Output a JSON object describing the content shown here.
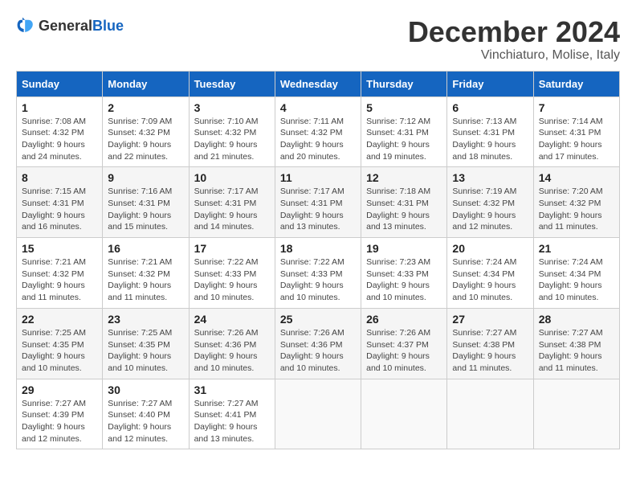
{
  "header": {
    "logo_general": "General",
    "logo_blue": "Blue",
    "month_title": "December 2024",
    "location": "Vinchiaturo, Molise, Italy"
  },
  "weekdays": [
    "Sunday",
    "Monday",
    "Tuesday",
    "Wednesday",
    "Thursday",
    "Friday",
    "Saturday"
  ],
  "weeks": [
    [
      {
        "day": "1",
        "sunrise": "7:08 AM",
        "sunset": "4:32 PM",
        "daylight": "9 hours and 24 minutes."
      },
      {
        "day": "2",
        "sunrise": "7:09 AM",
        "sunset": "4:32 PM",
        "daylight": "9 hours and 22 minutes."
      },
      {
        "day": "3",
        "sunrise": "7:10 AM",
        "sunset": "4:32 PM",
        "daylight": "9 hours and 21 minutes."
      },
      {
        "day": "4",
        "sunrise": "7:11 AM",
        "sunset": "4:32 PM",
        "daylight": "9 hours and 20 minutes."
      },
      {
        "day": "5",
        "sunrise": "7:12 AM",
        "sunset": "4:31 PM",
        "daylight": "9 hours and 19 minutes."
      },
      {
        "day": "6",
        "sunrise": "7:13 AM",
        "sunset": "4:31 PM",
        "daylight": "9 hours and 18 minutes."
      },
      {
        "day": "7",
        "sunrise": "7:14 AM",
        "sunset": "4:31 PM",
        "daylight": "9 hours and 17 minutes."
      }
    ],
    [
      {
        "day": "8",
        "sunrise": "7:15 AM",
        "sunset": "4:31 PM",
        "daylight": "9 hours and 16 minutes."
      },
      {
        "day": "9",
        "sunrise": "7:16 AM",
        "sunset": "4:31 PM",
        "daylight": "9 hours and 15 minutes."
      },
      {
        "day": "10",
        "sunrise": "7:17 AM",
        "sunset": "4:31 PM",
        "daylight": "9 hours and 14 minutes."
      },
      {
        "day": "11",
        "sunrise": "7:17 AM",
        "sunset": "4:31 PM",
        "daylight": "9 hours and 13 minutes."
      },
      {
        "day": "12",
        "sunrise": "7:18 AM",
        "sunset": "4:31 PM",
        "daylight": "9 hours and 13 minutes."
      },
      {
        "day": "13",
        "sunrise": "7:19 AM",
        "sunset": "4:32 PM",
        "daylight": "9 hours and 12 minutes."
      },
      {
        "day": "14",
        "sunrise": "7:20 AM",
        "sunset": "4:32 PM",
        "daylight": "9 hours and 11 minutes."
      }
    ],
    [
      {
        "day": "15",
        "sunrise": "7:21 AM",
        "sunset": "4:32 PM",
        "daylight": "9 hours and 11 minutes."
      },
      {
        "day": "16",
        "sunrise": "7:21 AM",
        "sunset": "4:32 PM",
        "daylight": "9 hours and 11 minutes."
      },
      {
        "day": "17",
        "sunrise": "7:22 AM",
        "sunset": "4:33 PM",
        "daylight": "9 hours and 10 minutes."
      },
      {
        "day": "18",
        "sunrise": "7:22 AM",
        "sunset": "4:33 PM",
        "daylight": "9 hours and 10 minutes."
      },
      {
        "day": "19",
        "sunrise": "7:23 AM",
        "sunset": "4:33 PM",
        "daylight": "9 hours and 10 minutes."
      },
      {
        "day": "20",
        "sunrise": "7:24 AM",
        "sunset": "4:34 PM",
        "daylight": "9 hours and 10 minutes."
      },
      {
        "day": "21",
        "sunrise": "7:24 AM",
        "sunset": "4:34 PM",
        "daylight": "9 hours and 10 minutes."
      }
    ],
    [
      {
        "day": "22",
        "sunrise": "7:25 AM",
        "sunset": "4:35 PM",
        "daylight": "9 hours and 10 minutes."
      },
      {
        "day": "23",
        "sunrise": "7:25 AM",
        "sunset": "4:35 PM",
        "daylight": "9 hours and 10 minutes."
      },
      {
        "day": "24",
        "sunrise": "7:26 AM",
        "sunset": "4:36 PM",
        "daylight": "9 hours and 10 minutes."
      },
      {
        "day": "25",
        "sunrise": "7:26 AM",
        "sunset": "4:36 PM",
        "daylight": "9 hours and 10 minutes."
      },
      {
        "day": "26",
        "sunrise": "7:26 AM",
        "sunset": "4:37 PM",
        "daylight": "9 hours and 10 minutes."
      },
      {
        "day": "27",
        "sunrise": "7:27 AM",
        "sunset": "4:38 PM",
        "daylight": "9 hours and 11 minutes."
      },
      {
        "day": "28",
        "sunrise": "7:27 AM",
        "sunset": "4:38 PM",
        "daylight": "9 hours and 11 minutes."
      }
    ],
    [
      {
        "day": "29",
        "sunrise": "7:27 AM",
        "sunset": "4:39 PM",
        "daylight": "9 hours and 12 minutes."
      },
      {
        "day": "30",
        "sunrise": "7:27 AM",
        "sunset": "4:40 PM",
        "daylight": "9 hours and 12 minutes."
      },
      {
        "day": "31",
        "sunrise": "7:27 AM",
        "sunset": "4:41 PM",
        "daylight": "9 hours and 13 minutes."
      },
      null,
      null,
      null,
      null
    ]
  ]
}
